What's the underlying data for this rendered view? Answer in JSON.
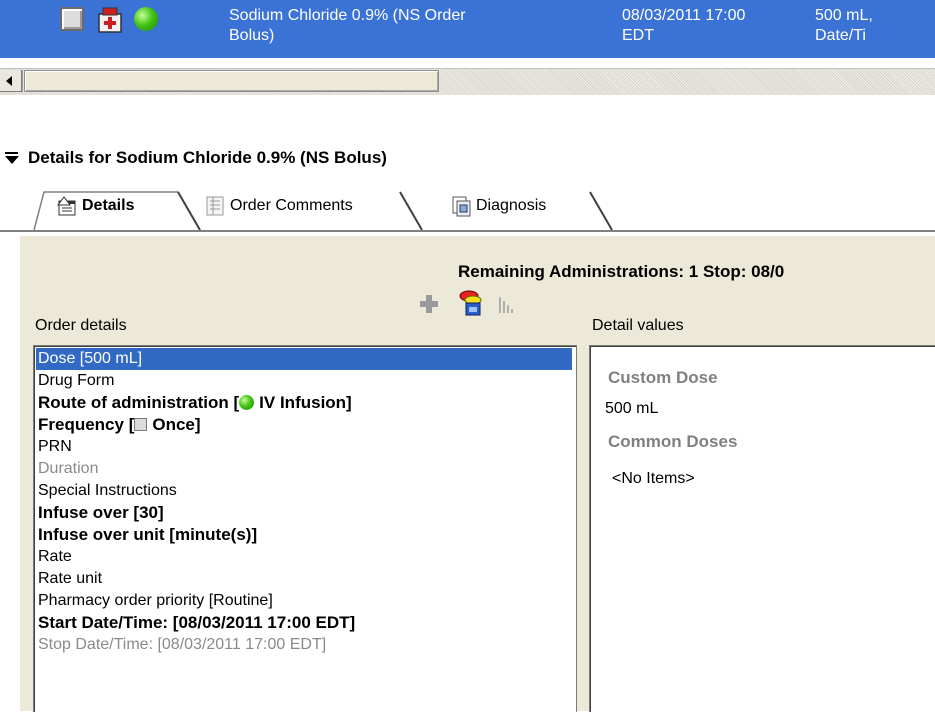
{
  "order_row": {
    "name": "Sodium Chloride 0.9% (NS  Order\nBolus)",
    "datetime": "08/03/2011 17:00\nEDT",
    "dose": "500 mL,\nDate/Ti",
    "icons": [
      "checkbox-icon",
      "medication-order-icon",
      "status-green-dot-icon"
    ],
    "colors": {
      "row_bg": "#3a72d6",
      "row_text": "#ffffff"
    }
  },
  "details_header": {
    "title": "Details for Sodium Chloride 0.9% (NS Bolus)"
  },
  "tabs": [
    {
      "label": "Details",
      "active": true,
      "icon": "properties-icon"
    },
    {
      "label": "Order Comments",
      "active": false,
      "icon": "comments-icon"
    },
    {
      "label": "Diagnosis",
      "active": false,
      "icon": "diagnosis-icon"
    }
  ],
  "panel": {
    "remaining": "Remaining Administrations: 1  Stop: 08/0",
    "toolbar_icons": [
      "add-icon",
      "pills-icon",
      "chart-bars-icon"
    ],
    "order_details_label": "Order details",
    "detail_values_label": "Detail values"
  },
  "order_details": [
    {
      "label": "Dose  [500 mL]",
      "style": "selected"
    },
    {
      "label": "Drug Form",
      "style": "normal"
    },
    {
      "label": "Route of administration   [",
      "suffix": "IV Infusion]",
      "style": "bold",
      "icon": "green-dot"
    },
    {
      "label": "Frequency   [",
      "suffix": "Once]",
      "style": "bold",
      "icon": "grey-box"
    },
    {
      "label": "PRN",
      "style": "normal"
    },
    {
      "label": "Duration",
      "style": "grey"
    },
    {
      "label": "Special Instructions",
      "style": "normal"
    },
    {
      "label": "Infuse over   [30]",
      "style": "bold"
    },
    {
      "label": "Infuse over unit   [minute(s)]",
      "style": "bold"
    },
    {
      "label": "Rate",
      "style": "normal"
    },
    {
      "label": "Rate unit",
      "style": "normal"
    },
    {
      "label": "Pharmacy order priority  [Routine]",
      "style": "normal"
    },
    {
      "label": "Start Date/Time:   [08/03/2011 17:00 EDT]",
      "style": "bold"
    },
    {
      "label": "Stop Date/Time:  [08/03/2011 17:00 EDT]",
      "style": "grey"
    }
  ],
  "detail_values": {
    "custom_dose_heading": "Custom Dose",
    "custom_dose_value": "500 mL",
    "common_doses_heading": "Common Doses",
    "common_doses_empty": "<No Items>"
  }
}
